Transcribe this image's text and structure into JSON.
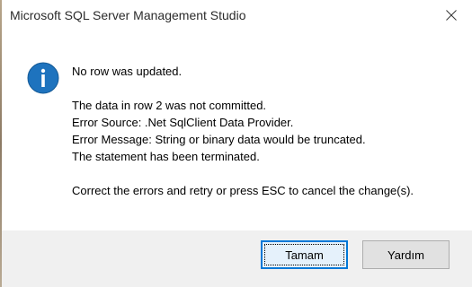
{
  "window": {
    "title": "Microsoft SQL Server Management Studio"
  },
  "icon": "info-icon",
  "message": {
    "headline": "No row was updated.",
    "details": [
      "The data in row 2 was not committed.",
      "Error Source: .Net SqlClient Data Provider.",
      "Error Message: String or binary data would be truncated.",
      "The statement has been terminated."
    ],
    "instruction": "Correct the errors and retry or press ESC to cancel the change(s)."
  },
  "buttons": {
    "ok_label": "Tamam",
    "help_label": "Yardım"
  },
  "colors": {
    "accent": "#0078d7",
    "footer": "#f0f0f0"
  }
}
